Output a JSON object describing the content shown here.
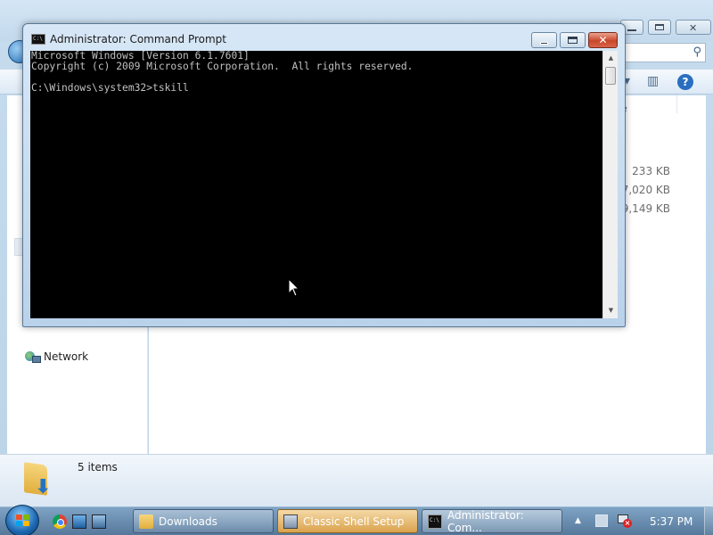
{
  "explorer": {
    "search_icon": "search-icon",
    "column_header_fragment": "e",
    "file_sizes": [
      "233 KB",
      "7,020 KB",
      "59,149 KB"
    ],
    "nav_network_label": "Network",
    "status_items": "5 items"
  },
  "cmd": {
    "title": "Administrator:  Command Prompt",
    "lines": [
      "Microsoft Windows [Version 6.1.7601]",
      "Copyright (c) 2009 Microsoft Corporation.  All rights reserved.",
      "",
      "C:\\Windows\\system32>tskill"
    ],
    "close_glyph": "✕"
  },
  "taskbar": {
    "tasks": [
      {
        "label": "Downloads"
      },
      {
        "label": "Classic Shell Setup"
      },
      {
        "label": "Administrator:  Com..."
      }
    ],
    "clock": "5:37 PM"
  },
  "colors": {
    "console_background": "#000000",
    "console_text": "#c0c0c0",
    "close_button": "#c8472a"
  }
}
